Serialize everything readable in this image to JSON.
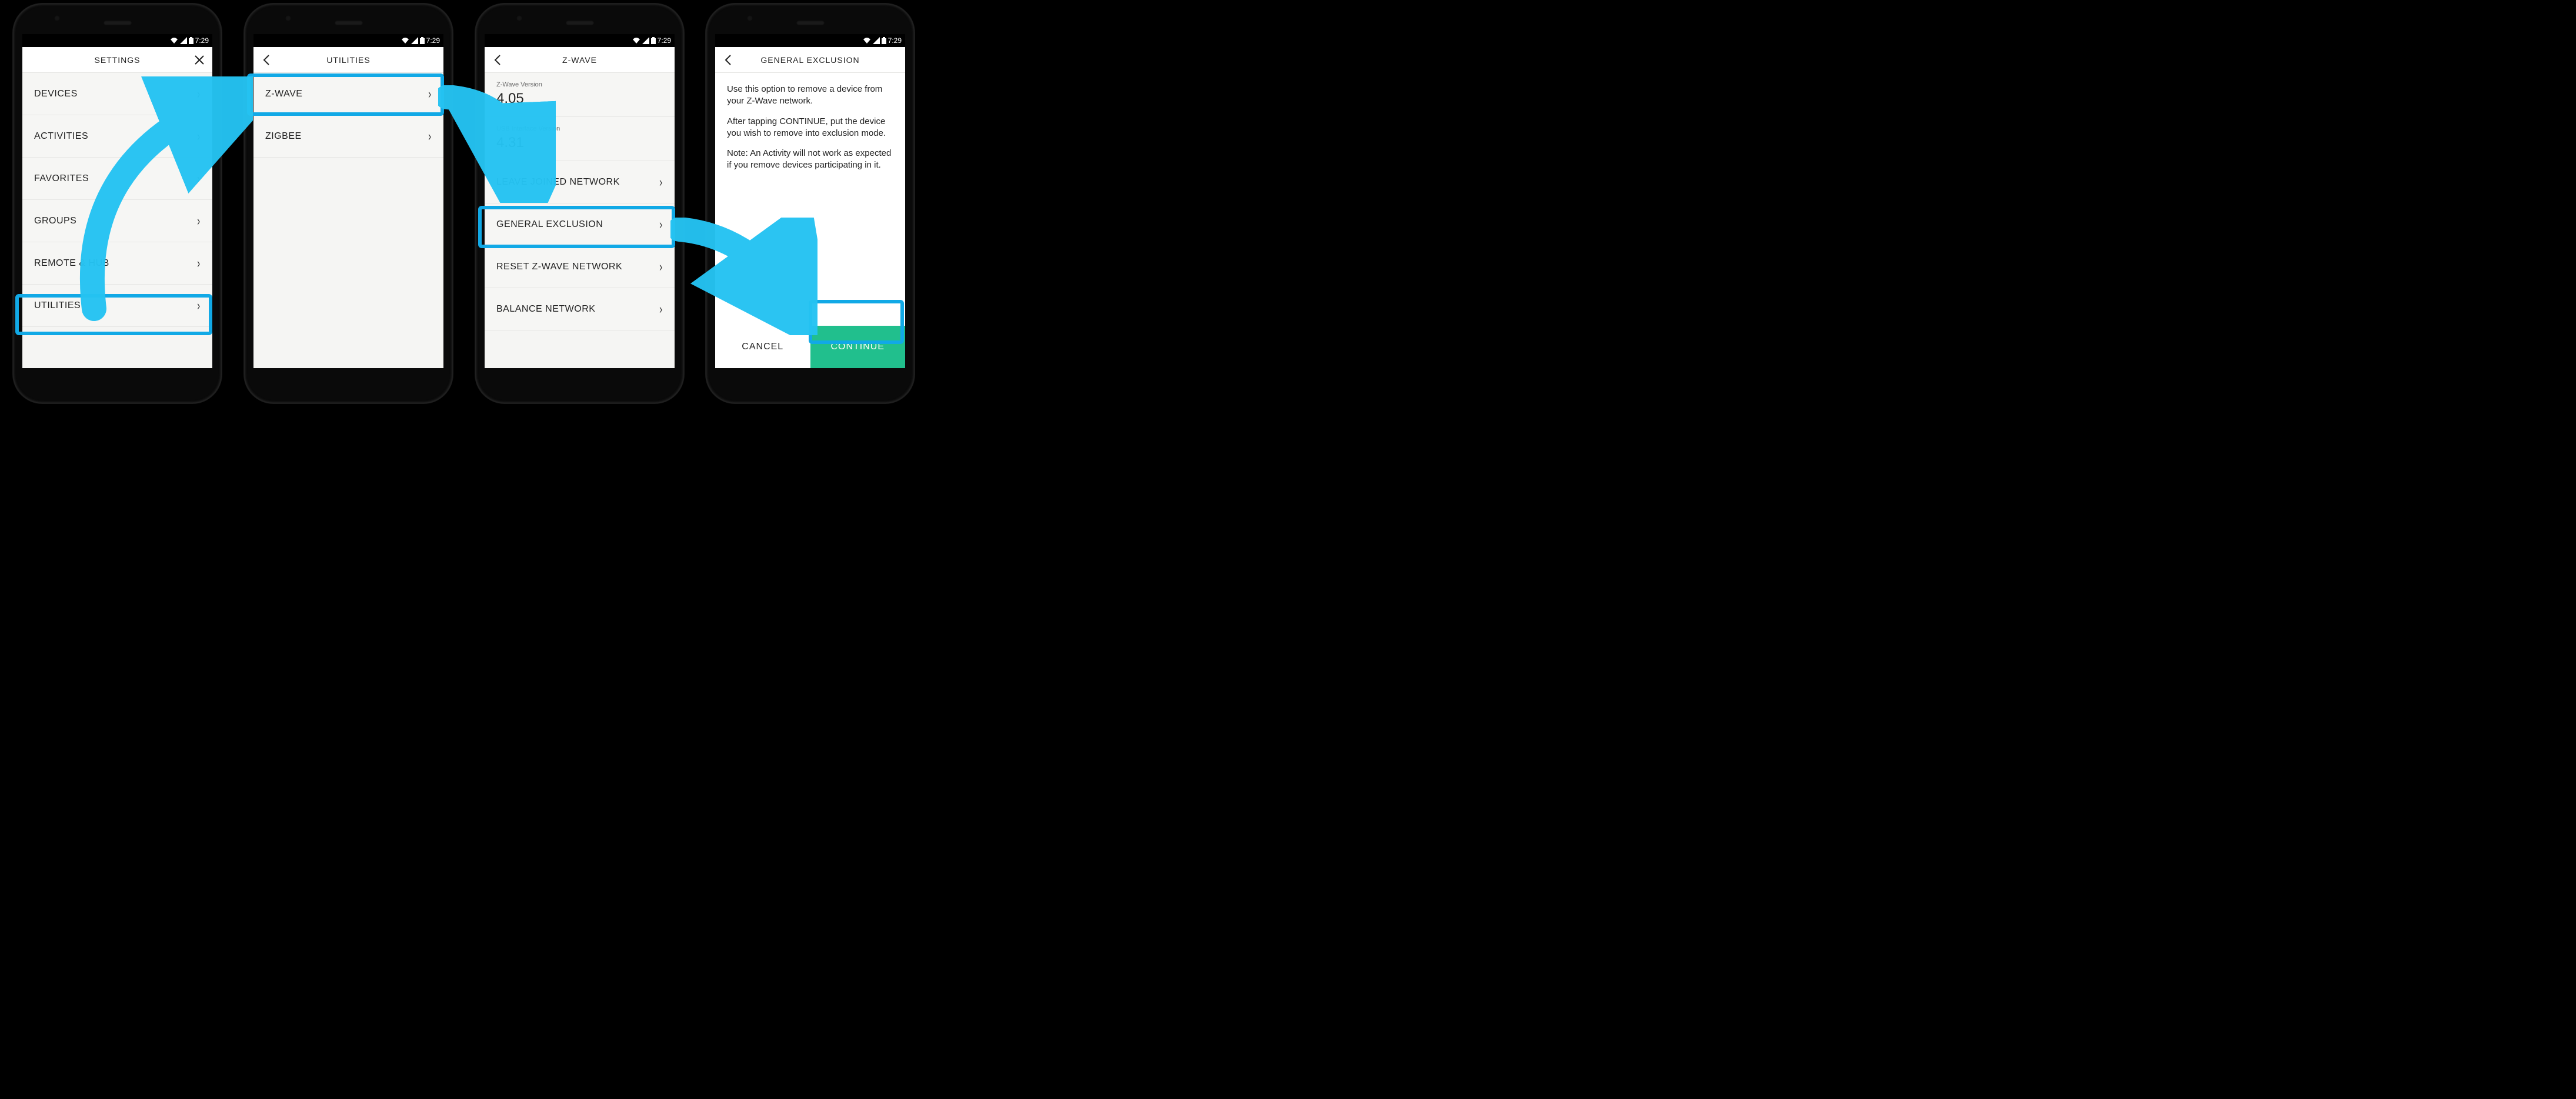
{
  "status": {
    "time": "7:29"
  },
  "screens": {
    "settings": {
      "title": "SETTINGS",
      "rows": [
        "DEVICES",
        "ACTIVITIES",
        "FAVORITES",
        "GROUPS",
        "REMOTE & HUB",
        "UTILITIES"
      ]
    },
    "utilities": {
      "title": "UTILITIES",
      "rows": [
        "Z-WAVE",
        "ZIGBEE"
      ]
    },
    "zwave": {
      "title": "Z-WAVE",
      "info": [
        {
          "k": "Z-Wave Version",
          "v": "4.05"
        },
        {
          "k": "USB Interface Version",
          "v": "4.31"
        }
      ],
      "rows": [
        "LEAVE JOINED NETWORK",
        "GENERAL EXCLUSION",
        "RESET Z-WAVE NETWORK",
        "BALANCE NETWORK"
      ]
    },
    "exclusion": {
      "title": "GENERAL EXCLUSION",
      "p1": "Use this option to remove a device from your Z-Wave network.",
      "p2": "After tapping CONTINUE, put the device you wish to remove into exclusion mode.",
      "p3": "Note: An Activity will not work as expected if you remove devices participating in it.",
      "cancel": "CANCEL",
      "continue": "CONTINUE"
    }
  },
  "highlight_color": "#11a9e6",
  "accent_color": "#21bf8d"
}
